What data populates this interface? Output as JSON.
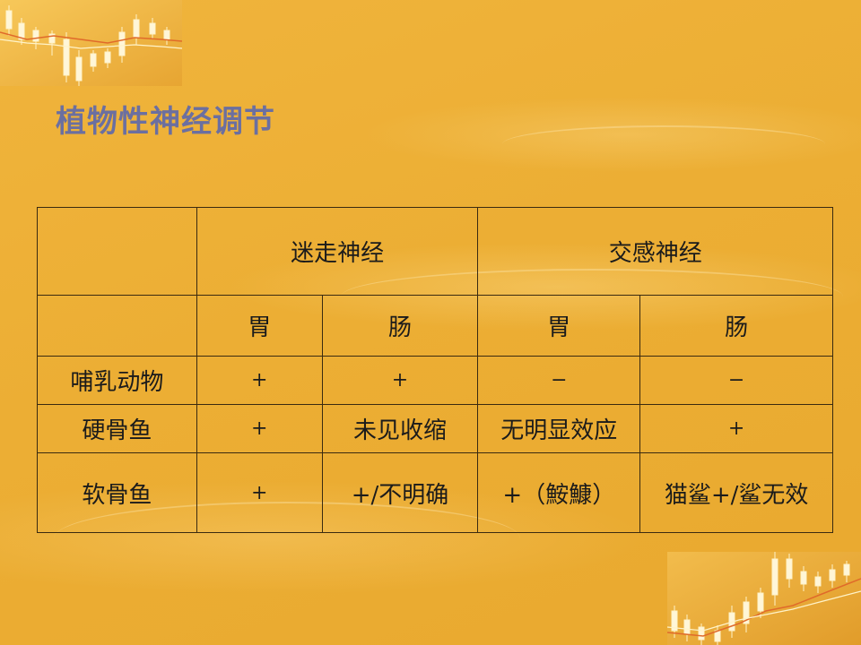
{
  "slide": {
    "title": "植物性神经调节",
    "colors": {
      "background": "#ECB23A",
      "title": "#6B6FA0",
      "border": "#3a2a10"
    },
    "decor": [
      "candlestick-chart-decoration-top-left",
      "candlestick-chart-decoration-bottom-right"
    ]
  },
  "table": {
    "group_headers": {
      "blank": "",
      "vagus": "迷走神经",
      "sympathetic": "交感神经"
    },
    "sub_headers": {
      "blank": "",
      "vagus_stomach": "胃",
      "vagus_intestine": "肠",
      "symp_stomach": "胃",
      "symp_intestine": "肠"
    },
    "rows": [
      {
        "animal": "哺乳动物",
        "vagus_stomach": "+",
        "vagus_intestine": "+",
        "symp_stomach": "−",
        "symp_intestine": "−"
      },
      {
        "animal": "硬骨鱼",
        "vagus_stomach": "+",
        "vagus_intestine": "未见收缩",
        "symp_stomach": "无明显效应",
        "symp_intestine": "+"
      },
      {
        "animal": "软骨鱼",
        "vagus_stomach": "+",
        "vagus_intestine": "+/不明确",
        "symp_stomach": "+（鮟鱇）",
        "symp_intestine": "猫鲨+/鲨无效"
      }
    ]
  }
}
